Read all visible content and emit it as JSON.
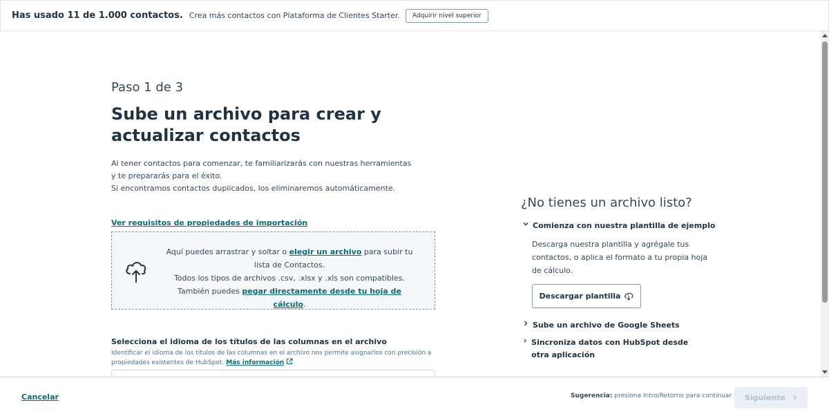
{
  "banner": {
    "usage": "Has usado 11 de 1.000 contactos.",
    "message": "Crea más contactos con Plataforma de Clientes Starter.",
    "upgrade_label": "Adquirir nivel superior"
  },
  "main": {
    "step": "Paso 1 de 3",
    "title": "Sube un archivo para crear y actualizar contactos",
    "desc_line1": "Al tener contactos para comenzar, te familiarizarás con nuestras herramientas y te prepararás para el éxito.",
    "desc_line2": "Si encontramos contactos duplicados, los eliminaremos automáticamente.",
    "requirements_link": "Ver requisitos de propiedades de importación",
    "dropzone": {
      "text_before": "Aquí puedes arrastrar y soltar o",
      "choose_link": "elegir un archivo",
      "text_after": "para subir tu lista de Contactos.",
      "types": "Todos los tipos de archivos .csv, .xlsx y .xls son compatibles.",
      "paste_before": "También puedes",
      "paste_link": "pegar directamente desde tu hoja de cálculo",
      "paste_after": ".",
      "icon": "cloud-upload-icon"
    },
    "language": {
      "title": "Selecciona el idioma de los títulos de las columnas en el archivo",
      "desc": "Identificar el idioma de los títulos de las columnas en el archivo nos permite asignarlos con precisión a propiedades existentes de HubSpot.",
      "more_link": "Más información"
    }
  },
  "side": {
    "title": "¿No tienes un archivo listo?",
    "items": [
      {
        "label": "Comienza con nuestra plantilla de ejemplo",
        "expanded": true
      },
      {
        "label": "Sube un archivo de Google Sheets",
        "expanded": false
      },
      {
        "label": "Sincroniza datos con HubSpot desde otra aplicación",
        "expanded": false
      }
    ],
    "template_body": "Descarga nuestra plantilla y agrégale tus contactos, o aplica el formato a tu propia hoja de cálculo.",
    "download_label": "Descargar plantilla"
  },
  "footer": {
    "cancel_label": "Cancelar",
    "hint_label": "Sugerencia:",
    "hint_text": "presiona Intro/Retorno para continuar",
    "next_label": "Siguiente"
  },
  "colors": {
    "link": "#0b6b73",
    "heading": "#213343",
    "text": "#33475b",
    "dropzone_bg": "#f5f8fa",
    "disabled_bg": "#eaf0f6"
  }
}
